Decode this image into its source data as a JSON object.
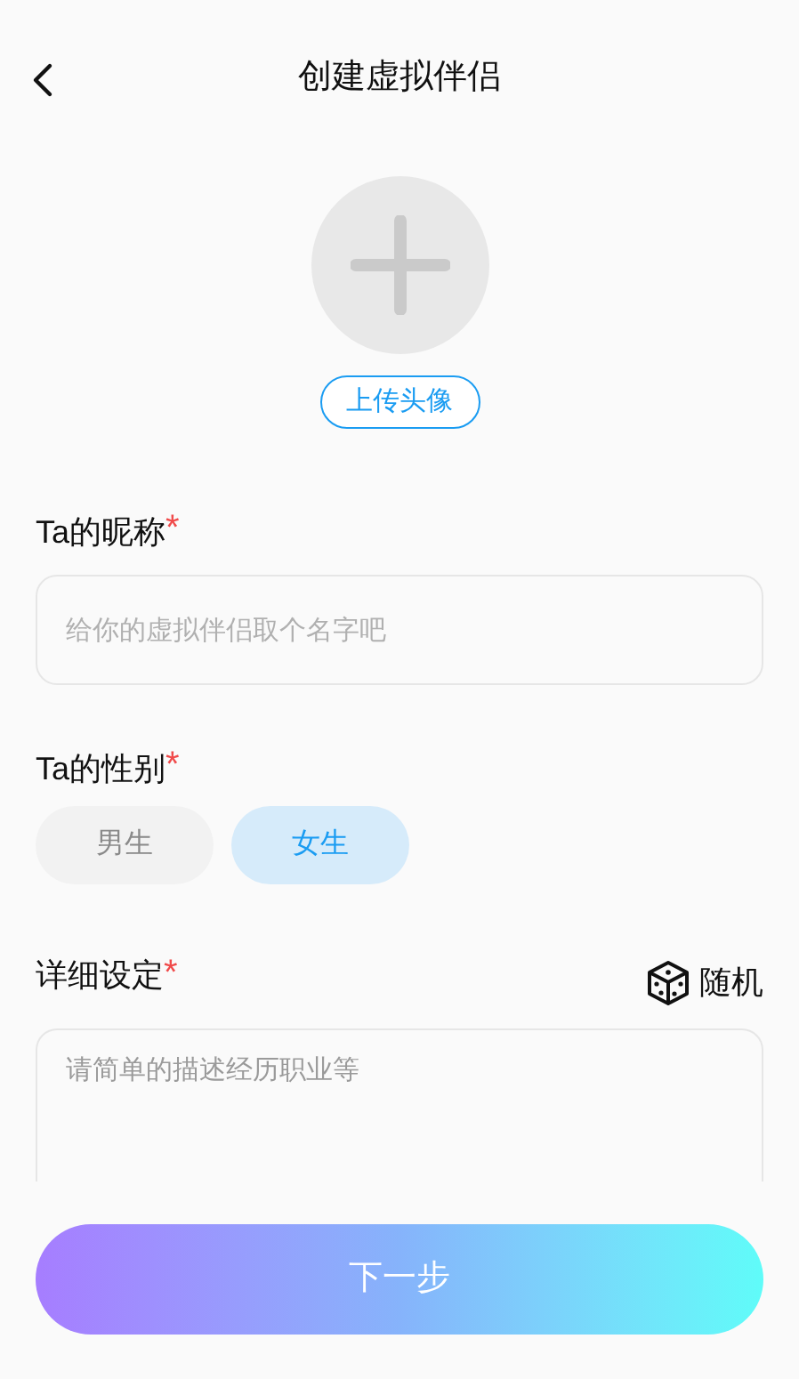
{
  "header": {
    "title": "创建虚拟伴侣"
  },
  "avatar": {
    "upload_button": "上传头像"
  },
  "nickname": {
    "label": "Ta的昵称",
    "required_mark": "*",
    "placeholder": "给你的虚拟伴侣取个名字吧"
  },
  "gender": {
    "label": "Ta的性别",
    "required_mark": "*",
    "options": [
      {
        "label": "男生",
        "selected": false
      },
      {
        "label": "女生",
        "selected": true
      }
    ]
  },
  "details": {
    "label": "详细设定",
    "required_mark": "*",
    "random_button": "随机",
    "placeholder": "请简单的描述经历职业等"
  },
  "next_button": "下一步"
}
